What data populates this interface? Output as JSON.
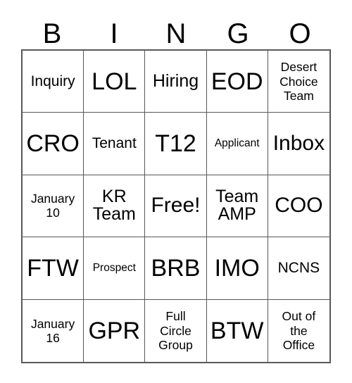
{
  "card": {
    "title": "BINGO",
    "header_letters": [
      "B",
      "I",
      "N",
      "G",
      "O"
    ],
    "border_color": "#58585a",
    "background_color": "#ffffff",
    "text_color": "#000000",
    "columns": 5,
    "rows": 5,
    "free_space_label": "Free!",
    "free_space_position": "row3-col3",
    "cells": [
      {
        "text": "Inquiry",
        "size": "sm"
      },
      {
        "text": "LOL",
        "size": "xl"
      },
      {
        "text": "Hiring",
        "size": "md"
      },
      {
        "text": "EOD",
        "size": "xl"
      },
      {
        "text": "Desert\nChoice\nTeam",
        "size": "xs"
      },
      {
        "text": "CRO",
        "size": "xl"
      },
      {
        "text": "Tenant",
        "size": "sm"
      },
      {
        "text": "T12",
        "size": "xl"
      },
      {
        "text": "Applicant",
        "size": "xxs"
      },
      {
        "text": "Inbox",
        "size": "lg"
      },
      {
        "text": "January\n10",
        "size": "xs"
      },
      {
        "text": "KR\nTeam",
        "size": "md"
      },
      {
        "text": "Free!",
        "size": "lg"
      },
      {
        "text": "Team\nAMP",
        "size": "md"
      },
      {
        "text": "COO",
        "size": "lg"
      },
      {
        "text": "FTW",
        "size": "xl"
      },
      {
        "text": "Prospect",
        "size": "xxs"
      },
      {
        "text": "BRB",
        "size": "xl"
      },
      {
        "text": "IMO",
        "size": "xl"
      },
      {
        "text": "NCNS",
        "size": "sm"
      },
      {
        "text": "January\n16",
        "size": "xs"
      },
      {
        "text": "GPR",
        "size": "xl"
      },
      {
        "text": "Full\nCircle\nGroup",
        "size": "xs"
      },
      {
        "text": "BTW",
        "size": "xl"
      },
      {
        "text": "Out of\nthe\nOffice",
        "size": "xs"
      }
    ]
  }
}
